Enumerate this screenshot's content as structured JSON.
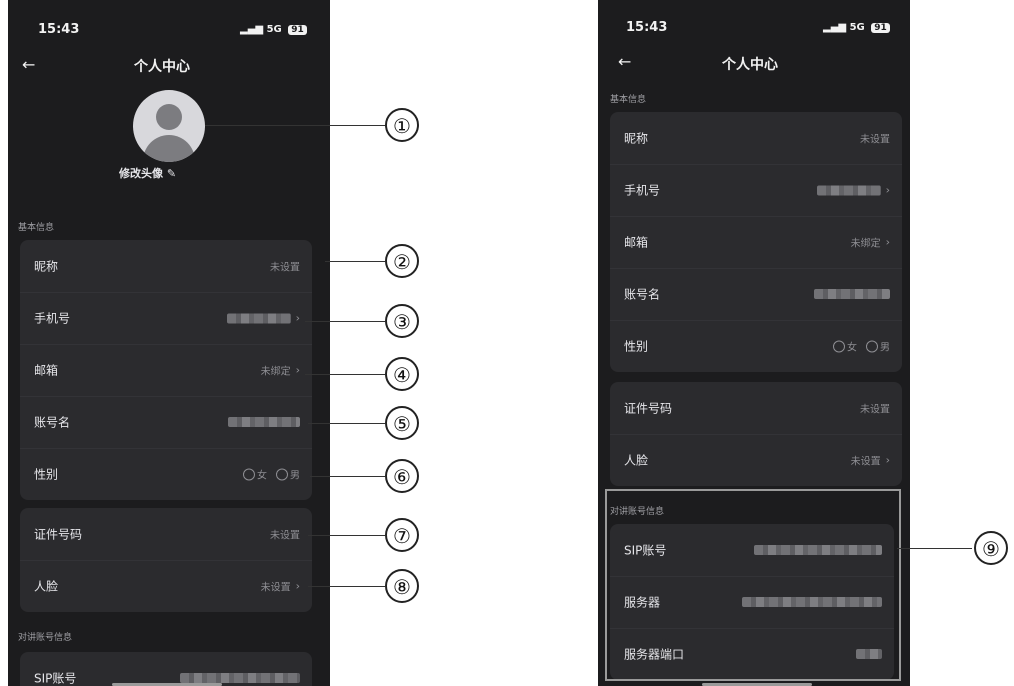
{
  "status": {
    "time": "15:43",
    "network": "5G",
    "battery": "91"
  },
  "header": {
    "back": "←",
    "title": "个人中心"
  },
  "avatar": {
    "edit_label": "修改头像 ✎"
  },
  "sections": {
    "basic": "基本信息",
    "intercom": "对讲账号信息"
  },
  "rows": {
    "nickname": {
      "label": "昵称",
      "value": "未设置"
    },
    "phone": {
      "label": "手机号",
      "value": ""
    },
    "email": {
      "label": "邮箱",
      "value": "未绑定"
    },
    "account": {
      "label": "账号名",
      "value": ""
    },
    "gender": {
      "label": "性别",
      "female": "女",
      "male": "男"
    },
    "id_number": {
      "label": "证件号码",
      "value": "未设置"
    },
    "face": {
      "label": "人脸",
      "value": "未设置"
    },
    "sip": {
      "label": "SIP账号",
      "value": ""
    },
    "server": {
      "label": "服务器",
      "value": ""
    },
    "server_port": {
      "label": "服务器端口",
      "value": ""
    }
  },
  "chevron": "›",
  "callouts": [
    "①",
    "②",
    "③",
    "④",
    "⑤",
    "⑥",
    "⑦",
    "⑧",
    "⑨"
  ]
}
